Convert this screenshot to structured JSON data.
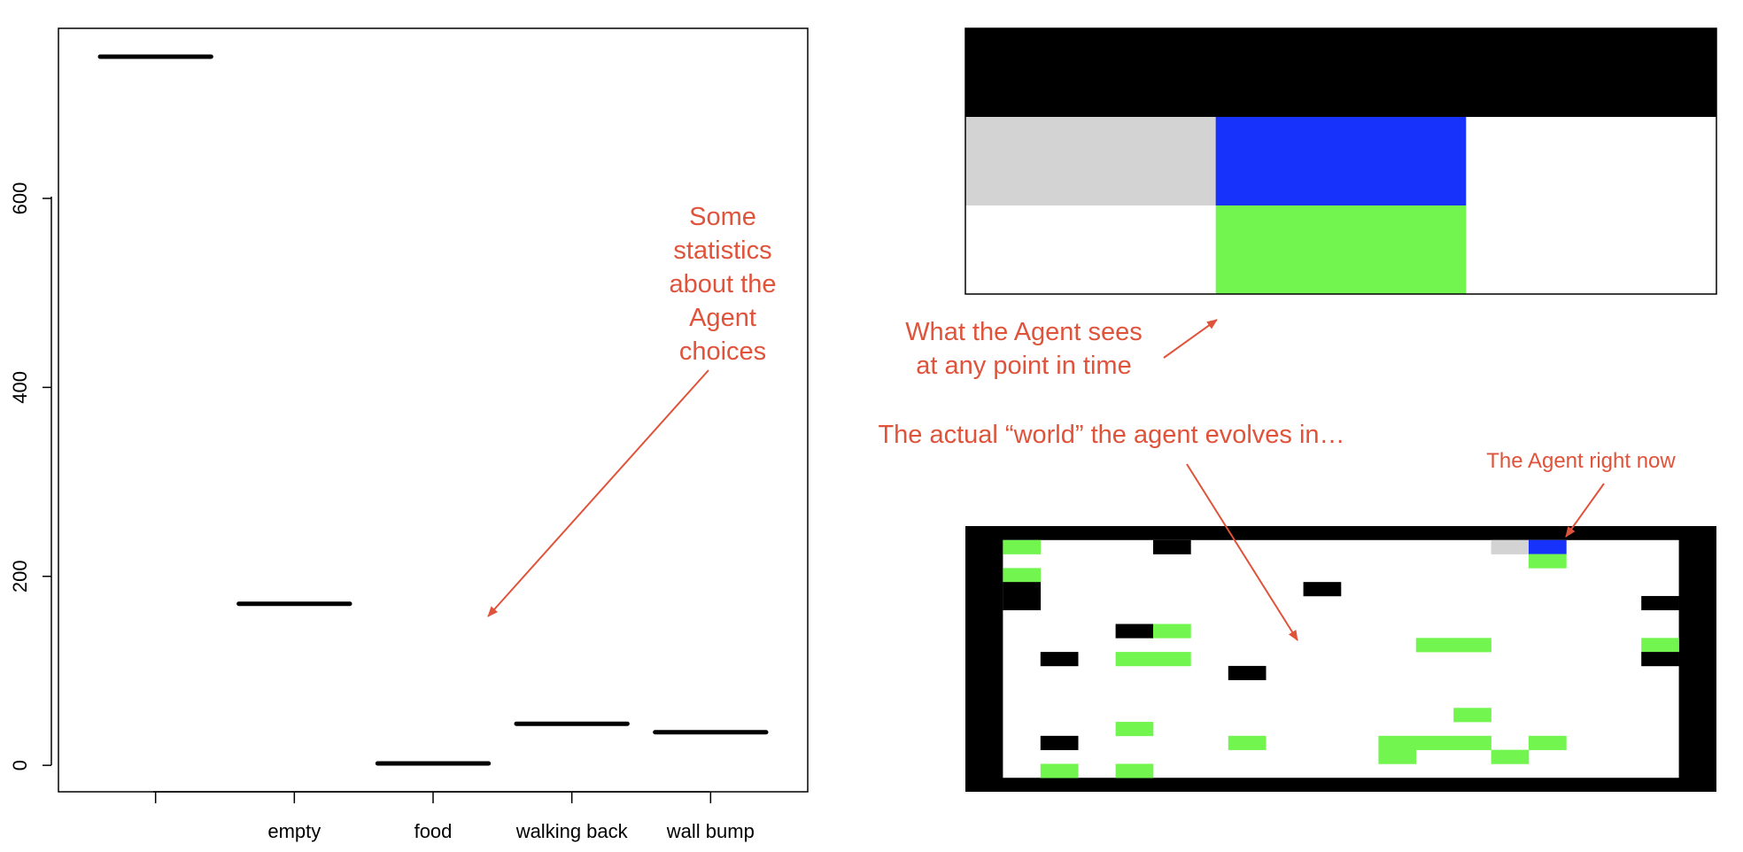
{
  "colors": {
    "annotation": "#e0533b",
    "wall": "#000000",
    "empty": "#ffffff",
    "visited": "#d3d3d3",
    "agent": "#1732fa",
    "food": "#72f54f"
  },
  "chart_data": {
    "type": "bar",
    "style": "horizontal segments",
    "categories": [
      "",
      "empty",
      "food",
      "walking back",
      "wall bump"
    ],
    "values": [
      750,
      171,
      2,
      44,
      35
    ],
    "yticks": [
      0,
      200,
      400,
      600
    ],
    "ylim": [
      -28,
      780
    ],
    "title": "",
    "xlabel": "",
    "ylabel": ""
  },
  "vision_grid": {
    "rows": [
      [
        "wall",
        "wall",
        "wall"
      ],
      [
        "visited",
        "agent",
        "empty"
      ],
      [
        "empty",
        "food",
        "empty"
      ]
    ]
  },
  "world_grid": {
    "cols": 20,
    "rows": 19,
    "border": "wall",
    "cells": [
      {
        "r": 1,
        "c": 1,
        "t": "food"
      },
      {
        "r": 1,
        "c": 5,
        "t": "wall"
      },
      {
        "r": 1,
        "c": 14,
        "t": "visited"
      },
      {
        "r": 1,
        "c": 15,
        "t": "agent"
      },
      {
        "r": 2,
        "c": 15,
        "t": "food"
      },
      {
        "r": 3,
        "c": 1,
        "t": "food"
      },
      {
        "r": 4,
        "c": 1,
        "t": "wall"
      },
      {
        "r": 4,
        "c": 9,
        "t": "wall"
      },
      {
        "r": 5,
        "c": 1,
        "t": "wall"
      },
      {
        "r": 5,
        "c": 18,
        "t": "wall"
      },
      {
        "r": 7,
        "c": 4,
        "t": "wall"
      },
      {
        "r": 7,
        "c": 5,
        "t": "food"
      },
      {
        "r": 8,
        "c": 12,
        "t": "food"
      },
      {
        "r": 8,
        "c": 13,
        "t": "food"
      },
      {
        "r": 8,
        "c": 18,
        "t": "food"
      },
      {
        "r": 9,
        "c": 2,
        "t": "wall"
      },
      {
        "r": 9,
        "c": 4,
        "t": "food"
      },
      {
        "r": 9,
        "c": 5,
        "t": "food"
      },
      {
        "r": 9,
        "c": 18,
        "t": "wall"
      },
      {
        "r": 10,
        "c": 7,
        "t": "wall"
      },
      {
        "r": 13,
        "c": 13,
        "t": "food"
      },
      {
        "r": 14,
        "c": 4,
        "t": "food"
      },
      {
        "r": 15,
        "c": 2,
        "t": "wall"
      },
      {
        "r": 15,
        "c": 7,
        "t": "food"
      },
      {
        "r": 15,
        "c": 11,
        "t": "food"
      },
      {
        "r": 15,
        "c": 12,
        "t": "food"
      },
      {
        "r": 15,
        "c": 13,
        "t": "food"
      },
      {
        "r": 15,
        "c": 15,
        "t": "food"
      },
      {
        "r": 16,
        "c": 11,
        "t": "food"
      },
      {
        "r": 16,
        "c": 14,
        "t": "food"
      },
      {
        "r": 17,
        "c": 2,
        "t": "food"
      },
      {
        "r": 17,
        "c": 4,
        "t": "food"
      }
    ]
  },
  "annotations": {
    "stats_line1": "Some",
    "stats_line2": "statistics",
    "stats_line3": "about the",
    "stats_line4": "Agent",
    "stats_line5": "choices",
    "vision_line1": "What the Agent sees",
    "vision_line2": "at any point in time",
    "world": "The actual “world” the agent evolves in…",
    "agent_now": "The Agent right now"
  }
}
